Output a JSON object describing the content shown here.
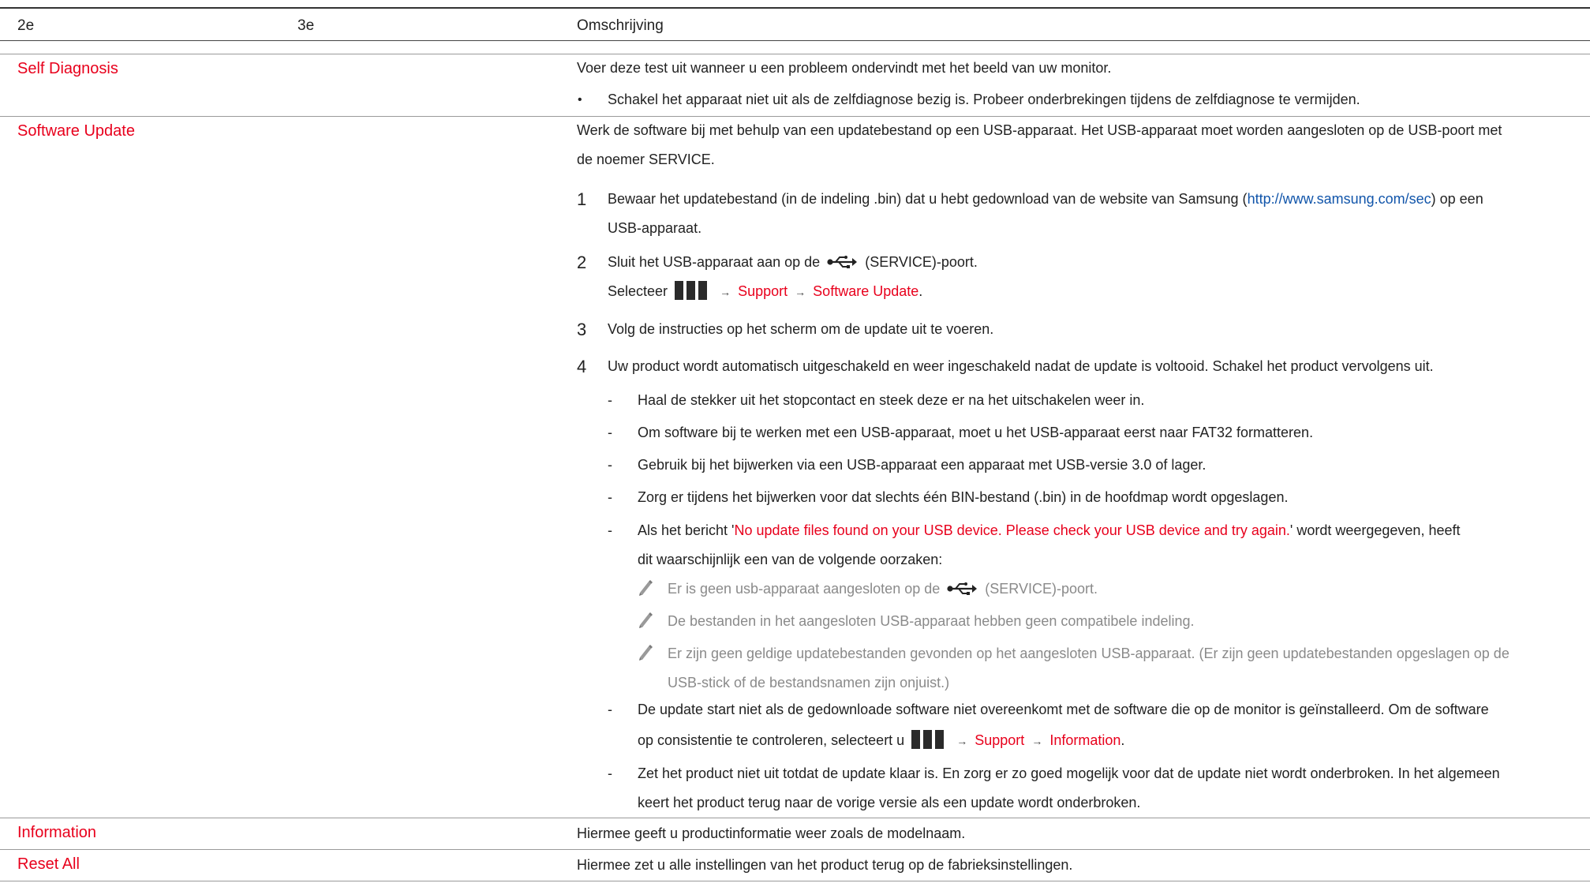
{
  "headers": {
    "col1": "2e",
    "col2": "3e",
    "col3": "Omschrijving"
  },
  "rows": {
    "self_diagnosis": {
      "label": "Self Diagnosis",
      "desc": "Voer deze test uit wanneer u een probleem ondervindt met het beeld van uw monitor.",
      "bullet": "•",
      "bullet_text": "Schakel het apparaat niet uit als de zelfdiagnose bezig is. Probeer onderbrekingen tijdens de zelfdiagnose te vermijden."
    },
    "software_update": {
      "label": "Software Update",
      "desc_line1": "Werk de software bij met behulp van een updatebestand op een USB-apparaat. Het USB-apparaat moet worden aangesloten op de USB-poort met",
      "desc_line2": "de noemer SERVICE.",
      "step1": {
        "num": "1",
        "text_a": "Bewaar het updatebestand (in de indeling .bin) dat u hebt gedownload van de website van Samsung (",
        "link": "http://www.samsung.com/sec",
        "text_b": ") op een",
        "text_c": "USB-apparaat."
      },
      "step2": {
        "num": "2",
        "text_a": "Sluit het USB-apparaat aan op de",
        "text_b": "(SERVICE)-poort.",
        "select_prefix": "Selecteer",
        "arrow": "→",
        "menu1": "Support",
        "menu2": "Software Update",
        "end": "."
      },
      "step3": {
        "num": "3",
        "text": "Volg de instructies op het scherm om de update uit te voeren."
      },
      "step4": {
        "num": "4",
        "text": "Uw product wordt automatisch uitgeschakeld en weer ingeschakeld nadat de update is voltooid. Schakel het product vervolgens uit."
      },
      "dash": "-",
      "notes": {
        "n1": "Haal de stekker uit het stopcontact en steek deze er na het uitschakelen weer in.",
        "n2": "Om software bij te werken met een USB-apparaat, moet u het USB-apparaat eerst naar FAT32 formatteren.",
        "n3": "Gebruik bij het bijwerken via een USB-apparaat een apparaat met USB-versie 3.0 of lager.",
        "n4": "Zorg er tijdens het bijwerken voor dat slechts één BIN-bestand (.bin) in de hoofdmap wordt opgeslagen.",
        "n5_a": "Als het bericht '",
        "n5_msg": "No update files found on your USB device. Please check your USB device and try again.",
        "n5_b": "' wordt weergegeven, heeft",
        "n5_c": "dit waarschijnlijk een van de volgende oorzaken:",
        "n6_a": "De update start niet als de gedownloade software niet overeenkomt met de software die op de monitor is geïnstalleerd. Om de software",
        "n6_b": "op consistentie te controleren, selecteert u",
        "n6_menu1": "Support",
        "n6_menu2": "Information",
        "n7_a": "Zet het product niet uit totdat de update klaar is. En zorg er zo goed mogelijk voor dat de update niet wordt onderbroken. In het algemeen",
        "n7_b": "keert het product terug naar de vorige versie als een update wordt onderbroken."
      },
      "causes": {
        "c1_a": "Er is geen usb-apparaat aangesloten op de",
        "c1_b": "(SERVICE)-poort.",
        "c2": "De bestanden in het aangesloten USB-apparaat hebben geen compatibele indeling.",
        "c3_a": "Er zijn geen geldige updatebestanden gevonden op het aangesloten USB-apparaat. (Er zijn geen updatebestanden opgeslagen op de",
        "c3_b": "USB-stick of de bestandsnamen zijn onjuist.)"
      }
    },
    "information": {
      "label": "Information",
      "desc": "Hiermee geeft u productinformatie weer zoals de modelnaam."
    },
    "reset_all": {
      "label": "Reset All",
      "desc": "Hiermee zet u alle instellingen van het product terug op de fabrieksinstellingen."
    }
  },
  "colors": {
    "accent_red": "#e8001c",
    "link_blue": "#1155aa",
    "note_gray": "#8a8a8a"
  },
  "icons": {
    "menu": "menu-icon",
    "usb": "usb-icon",
    "note": "pencil-note-icon"
  }
}
